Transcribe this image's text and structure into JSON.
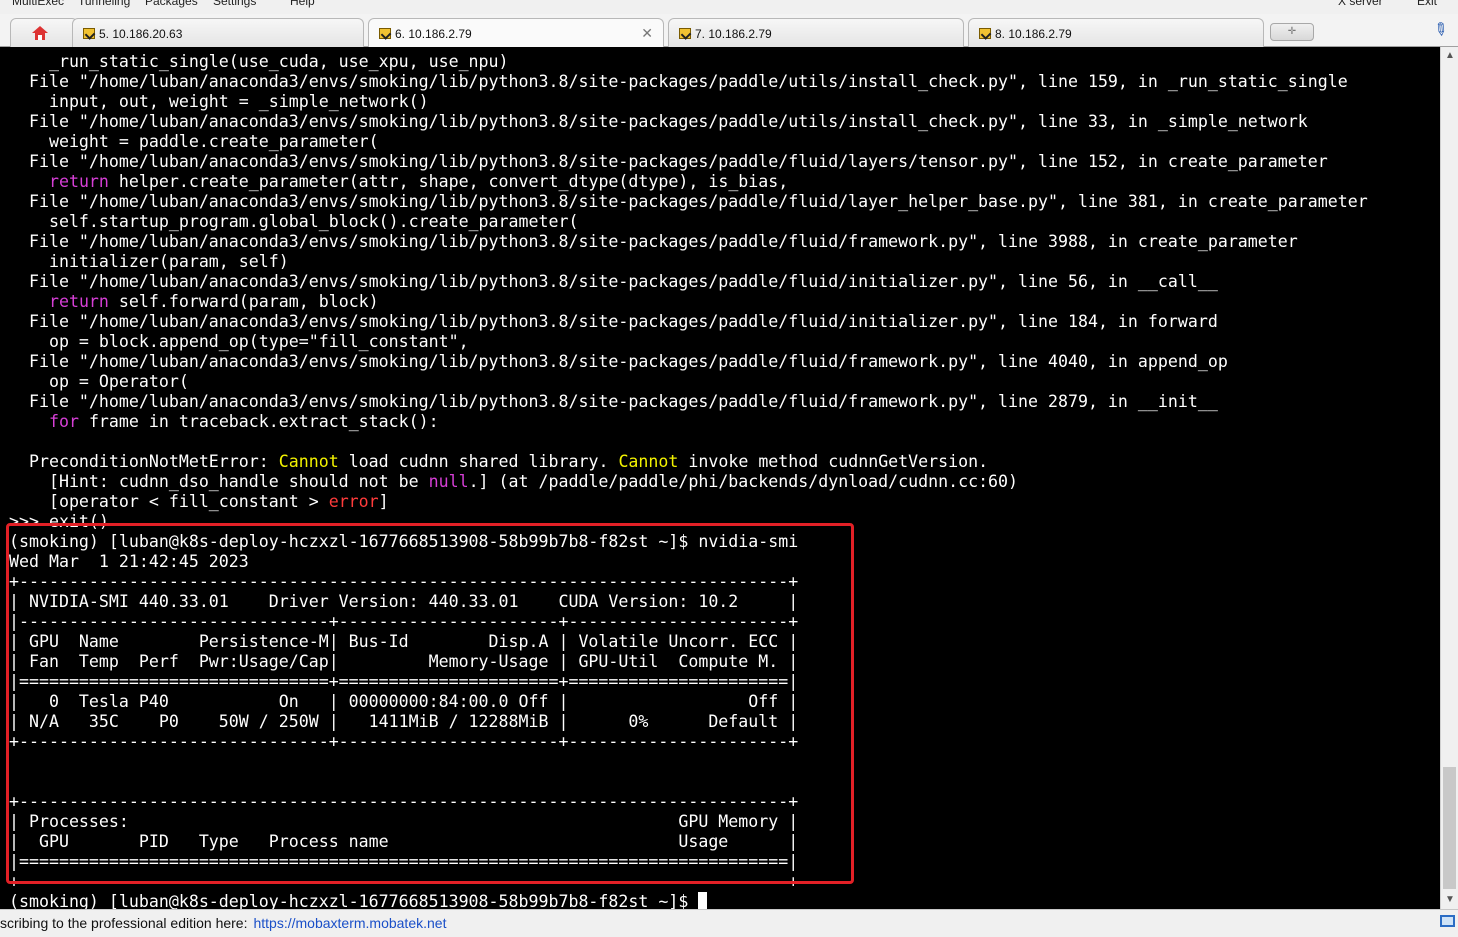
{
  "menu": {
    "items": [
      "MultiExec",
      "Tunneling",
      "Packages",
      "Settings",
      "Help"
    ],
    "right_items": [
      "X server",
      "Exit"
    ]
  },
  "tabs": [
    {
      "label": "5. 10.186.20.63",
      "active": false
    },
    {
      "label": "6. 10.186.2.79",
      "active": true
    },
    {
      "label": "7. 10.186.2.79",
      "active": false
    },
    {
      "label": "8. 10.186.2.79",
      "active": false
    }
  ],
  "tab_close_glyph": "✕",
  "new_tab_glyph": "✛",
  "terminal": {
    "lines": [
      [
        {
          "t": "    _run_static_single(use_cuda, use_xpu, use_npu)"
        }
      ],
      [
        {
          "t": "  File \"/home/luban/anaconda3/envs/smoking/lib/python3.8/site-packages/paddle/utils/install_check.py\", line 159, in _run_static_single"
        }
      ],
      [
        {
          "t": "    input, out, weight = _simple_network()"
        }
      ],
      [
        {
          "t": "  File \"/home/luban/anaconda3/envs/smoking/lib/python3.8/site-packages/paddle/utils/install_check.py\", line 33, in _simple_network"
        }
      ],
      [
        {
          "t": "    weight = paddle.create_parameter("
        }
      ],
      [
        {
          "t": "  File \"/home/luban/anaconda3/envs/smoking/lib/python3.8/site-packages/paddle/fluid/layers/tensor.py\", line 152, in create_parameter"
        }
      ],
      [
        {
          "t": "    "
        },
        {
          "t": "return",
          "c": "kw"
        },
        {
          "t": " helper.create_parameter(attr, shape, convert_dtype(dtype), is_bias,"
        }
      ],
      [
        {
          "t": "  File \"/home/luban/anaconda3/envs/smoking/lib/python3.8/site-packages/paddle/fluid/layer_helper_base.py\", line 381, in create_parameter"
        }
      ],
      [
        {
          "t": "    self.startup_program.global_block().create_parameter("
        }
      ],
      [
        {
          "t": "  File \"/home/luban/anaconda3/envs/smoking/lib/python3.8/site-packages/paddle/fluid/framework.py\", line 3988, in create_parameter"
        }
      ],
      [
        {
          "t": "    initializer(param, self)"
        }
      ],
      [
        {
          "t": "  File \"/home/luban/anaconda3/envs/smoking/lib/python3.8/site-packages/paddle/fluid/initializer.py\", line 56, in __call__"
        }
      ],
      [
        {
          "t": "    "
        },
        {
          "t": "return",
          "c": "kw"
        },
        {
          "t": " self.forward(param, block)"
        }
      ],
      [
        {
          "t": "  File \"/home/luban/anaconda3/envs/smoking/lib/python3.8/site-packages/paddle/fluid/initializer.py\", line 184, in forward"
        }
      ],
      [
        {
          "t": "    op = block.append_op(type=\"fill_constant\","
        }
      ],
      [
        {
          "t": "  File \"/home/luban/anaconda3/envs/smoking/lib/python3.8/site-packages/paddle/fluid/framework.py\", line 4040, in append_op"
        }
      ],
      [
        {
          "t": "    op = Operator("
        }
      ],
      [
        {
          "t": "  File \"/home/luban/anaconda3/envs/smoking/lib/python3.8/site-packages/paddle/fluid/framework.py\", line 2879, in __init__"
        }
      ],
      [
        {
          "t": "    "
        },
        {
          "t": "for",
          "c": "kw"
        },
        {
          "t": " frame in traceback.extract_stack():"
        }
      ],
      [
        {
          "t": ""
        }
      ],
      [
        {
          "t": "  PreconditionNotMetError: "
        },
        {
          "t": "Cannot",
          "c": "exc"
        },
        {
          "t": " load cudnn shared library. "
        },
        {
          "t": "Cannot",
          "c": "exc"
        },
        {
          "t": " invoke method cudnnGetVersion."
        }
      ],
      [
        {
          "t": "    [Hint: cudnn_dso_handle should not be "
        },
        {
          "t": "null",
          "c": "kw"
        },
        {
          "t": ".] (at /paddle/paddle/phi/backends/dynload/cudnn.cc:60)"
        }
      ],
      [
        {
          "t": "    [operator < fill_constant > "
        },
        {
          "t": "error",
          "c": "err"
        },
        {
          "t": "]"
        }
      ],
      [
        {
          "t": ">>> exit()"
        }
      ],
      [
        {
          "t": "(smoking) [luban@k8s-deploy-hczxzl-1677668513908-58b99b7b8-f82st ~]$ nvidia-smi"
        }
      ],
      [
        {
          "t": "Wed Mar  1 21:42:45 2023"
        }
      ],
      [
        {
          "t": "+-----------------------------------------------------------------------------+"
        }
      ],
      [
        {
          "t": "| NVIDIA-SMI 440.33.01    Driver Version: 440.33.01    CUDA Version: 10.2     |"
        }
      ],
      [
        {
          "t": "|-------------------------------+----------------------+----------------------+"
        }
      ],
      [
        {
          "t": "| GPU  Name        Persistence-M| Bus-Id        Disp.A | Volatile Uncorr. ECC |"
        }
      ],
      [
        {
          "t": "| Fan  Temp  Perf  Pwr:Usage/Cap|         Memory-Usage | GPU-Util  Compute M. |"
        }
      ],
      [
        {
          "t": "|===============================+======================+======================|"
        }
      ],
      [
        {
          "t": "|   0  Tesla P40           On   | 00000000:84:00.0 Off |                  Off |"
        }
      ],
      [
        {
          "t": "| N/A   35C    P0    50W / 250W |   1411MiB / 12288MiB |      0%      Default |"
        }
      ],
      [
        {
          "t": "+-------------------------------+----------------------+----------------------+"
        }
      ],
      [
        {
          "t": ""
        }
      ],
      [
        {
          "t": ""
        }
      ],
      [
        {
          "t": "+-----------------------------------------------------------------------------+"
        }
      ],
      [
        {
          "t": "| Processes:                                                       GPU Memory |"
        }
      ],
      [
        {
          "t": "|  GPU       PID   Type   Process name                             Usage      |"
        }
      ],
      [
        {
          "t": "|=============================================================================|"
        }
      ],
      [
        {
          "t": "+-----------------------------------------------------------------------------+"
        }
      ],
      [
        {
          "t": "(smoking) [luban@k8s-deploy-hczxzl-1677668513908-58b99b7b8-f82st ~]$ "
        }
      ]
    ],
    "colors": {
      "background": "#000000",
      "text": "#ffffff",
      "keyword": "#d63fd6",
      "exception": "#f2f200",
      "error": "#ff3b3b",
      "highlight_box": "#e22026"
    }
  },
  "status": {
    "text": "scribing to the professional edition here:",
    "link": "https://mobaxterm.mobatek.net"
  }
}
